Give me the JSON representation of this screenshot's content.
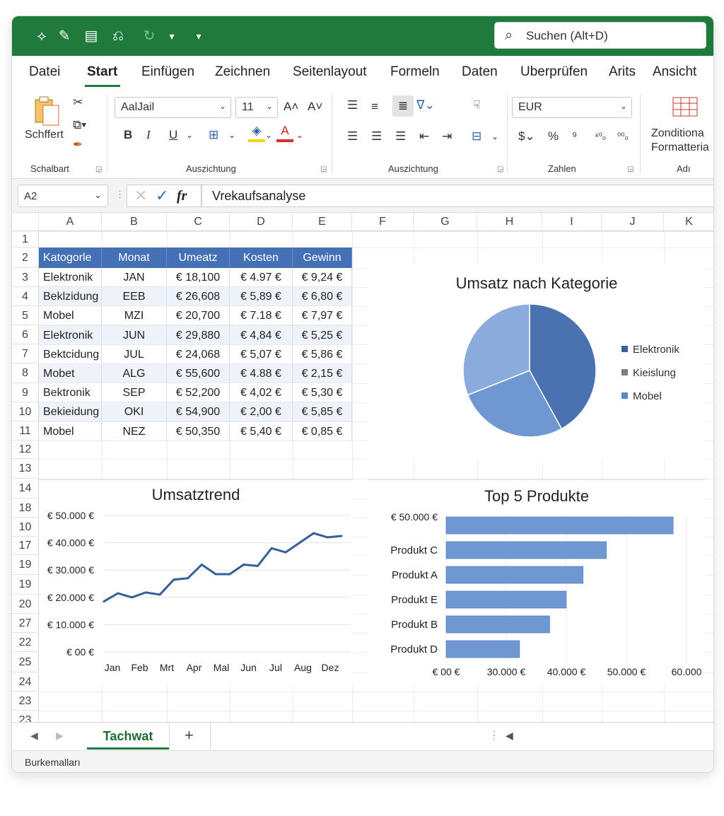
{
  "quick_access": {
    "search_placeholder": "Suchen (Alt+D)"
  },
  "tabs": [
    "Datei",
    "Start",
    "Einfügen",
    "Zeichnen",
    "Seitenlayout",
    "Formeln",
    "Daten",
    "Uberprüfen",
    "Arits",
    "Ansicht"
  ],
  "active_tab": "Start",
  "ribbon": {
    "clipboard": {
      "paste_label": "Schffert",
      "group_label": "Schalbart"
    },
    "font": {
      "font_name": "AalJail",
      "font_size": "11",
      "group_label": "Auszichtung"
    },
    "alignment": {
      "group_label": "Auszichtung"
    },
    "number": {
      "format": "EUR",
      "group_label": "Zahlen"
    },
    "styles": {
      "cond_label_1": "Zonditiona",
      "cond_label_2": "Formatteria",
      "group_label": "Adı"
    }
  },
  "formula_bar": {
    "name_box": "A2",
    "formula": "Vrekaufsanalyse"
  },
  "columns": [
    "A",
    "B",
    "C",
    "D",
    "E",
    "F",
    "G",
    "H",
    "I",
    "J",
    "K"
  ],
  "row_headers": [
    "1",
    "2",
    "3",
    "4",
    "5",
    "6",
    "7",
    "8",
    "9",
    "10",
    "11",
    "12",
    "13",
    "14",
    "18",
    "10",
    "17",
    "19",
    "19",
    "20",
    "27",
    "22",
    "25",
    "24",
    "23",
    "23"
  ],
  "table": {
    "headers": [
      "Katogorle",
      "Monat",
      "Umeatz",
      "Kosten",
      "Gewinn"
    ],
    "rows": [
      [
        "Elektronik",
        "JAN",
        "€ 18,100",
        "€ 4.97 €",
        "€ 9,24 €"
      ],
      [
        "Beklzidung",
        "EEB",
        "€ 26,608",
        "€ 5,89 €",
        "€ 6,80 €"
      ],
      [
        "Mobel",
        "MZI",
        "€ 20,700",
        "€ 7.18 €",
        "€ 7,97 €"
      ],
      [
        "Elektronik",
        "JUN",
        "€ 29,880",
        "€ 4,84 €",
        "€ 5,25 €"
      ],
      [
        "Bektcidung",
        "JUL",
        "€ 24,068",
        "€ 5,07 €",
        "€ 5,86 €"
      ],
      [
        "Mobet",
        "ALG",
        "€ 55,600",
        "€ 4.88 €",
        "€ 2,15 €"
      ],
      [
        "Bektronik",
        "SEP",
        "€ 52,200",
        "€ 4,02 €",
        "€ 5,30 €"
      ],
      [
        "Bekieidung",
        "OKI",
        "€ 54,900",
        "€ 2,00 €",
        "€ 5,85 €"
      ],
      [
        "Mobel",
        "NEZ",
        "€ 50,350",
        "€ 5,40 €",
        "€ 0,85 €"
      ]
    ]
  },
  "chart_data": [
    {
      "type": "pie",
      "title": "Umsatz nach Kategorie",
      "categories": [
        "Elektronik",
        "Kieislung",
        "Mobel"
      ],
      "values": [
        42,
        27,
        31
      ],
      "colors": [
        "#4a72b0",
        "#6f98d3",
        "#8aabdc"
      ],
      "legend_colors": [
        "#3d62a3",
        "#7f7f7f",
        "#5b86c9"
      ],
      "legend": "right"
    },
    {
      "type": "line",
      "title": "Umsatztrend",
      "x": [
        "Jan",
        "Feb",
        "Mrt",
        "Apr",
        "Mal",
        "Jun",
        "Jul",
        "Aug",
        "Dez"
      ],
      "series": [
        {
          "values": [
            18500,
            21500,
            20000,
            21800,
            21000,
            26500,
            27000,
            32000,
            28500,
            28500,
            32000,
            31500,
            38000,
            36500,
            40000,
            43500,
            42000,
            42500
          ],
          "color": "#355f9a"
        }
      ],
      "yticks": [
        "€ 00 €",
        "€ 10.000 €",
        "€ 20.000 €",
        "€ 30.000 €",
        "€ 40.000 €",
        "€ 50.000 €"
      ],
      "ylim": [
        0,
        50000
      ],
      "grid": true
    },
    {
      "type": "bar",
      "orientation": "horizontal",
      "title": "Top 5 Produkte",
      "categories": [
        "",
        "Produkt C",
        "Produkt A",
        "Produkt E",
        "Produkt B",
        "Produkt D"
      ],
      "category_top_label": "€ 50.000 €",
      "values": [
        58000,
        48000,
        44500,
        42000,
        39500,
        35000
      ],
      "xticks": [
        "€ 00 €",
        "30.000 €",
        "40.000 €",
        "50.000 €",
        "60.000"
      ],
      "xlim": [
        24000,
        60000
      ],
      "color": "#6f98d3",
      "grid": true
    }
  ],
  "sheet_tabs": {
    "active": "Tachwat",
    "add_label": "+"
  },
  "status_text": "Burkemalları"
}
